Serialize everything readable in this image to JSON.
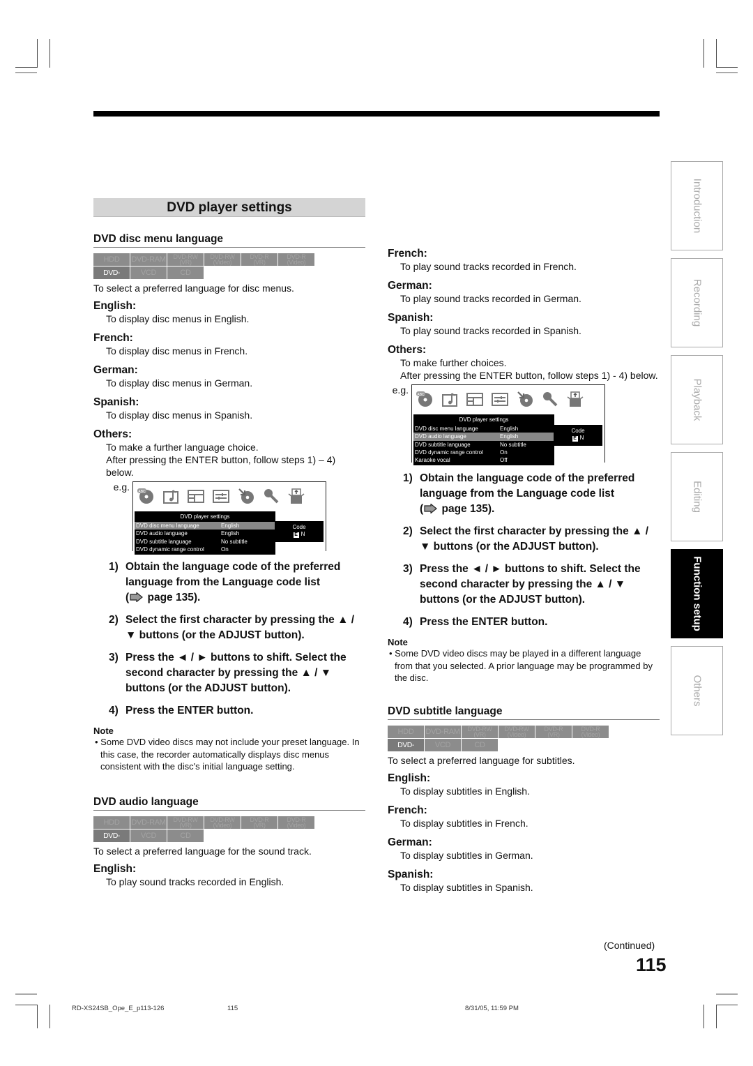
{
  "page": {
    "title": "DVD player settings",
    "continued": "(Continued)",
    "page_number": "115"
  },
  "badges": {
    "row1": [
      {
        "label": "HDD",
        "active": false
      },
      {
        "label": "DVD-RAM",
        "active": false
      },
      {
        "label": "DVD-RW (VR)",
        "l1": "DVD-RW",
        "l2": "(VR)",
        "active": false
      },
      {
        "label": "DVD-RW (Video)",
        "l1": "DVD-RW",
        "l2": "(Video)",
        "active": false
      },
      {
        "label": "DVD-R (VR)",
        "l1": "DVD-R",
        "l2": "(VR)",
        "active": false
      },
      {
        "label": "DVD-R (Video)",
        "l1": "DVD-R",
        "l2": "(Video)",
        "active": false
      }
    ],
    "row2": [
      {
        "label": "DVD-VIDEO",
        "active": true
      },
      {
        "label": "VCD",
        "active": false
      },
      {
        "label": "CD",
        "active": false
      }
    ]
  },
  "disc_menu": {
    "heading": "DVD disc menu language",
    "lead": "To select a preferred language for disc menus.",
    "options": [
      {
        "label": "English:",
        "desc": "To display disc menus in English."
      },
      {
        "label": "French:",
        "desc": "To display disc menus in French."
      },
      {
        "label": "German:",
        "desc": "To display disc menus in German."
      },
      {
        "label": "Spanish:",
        "desc": "To display disc menus in Spanish."
      },
      {
        "label": "Others:",
        "desc": "To make a further language choice.",
        "desc2": "After pressing the ENTER button, follow steps 1) – 4) below."
      }
    ],
    "eg": "e.g.",
    "screen": {
      "title": "DVD player settings",
      "rows": [
        {
          "k": "DVD disc menu language",
          "v": "English",
          "selected": true
        },
        {
          "k": "DVD audio language",
          "v": "English",
          "selected": false
        },
        {
          "k": "DVD subtitle language",
          "v": "No subtitle",
          "selected": false
        },
        {
          "k": "DVD dynamic range control",
          "v": "On",
          "selected": false
        }
      ],
      "code_label": "Code",
      "code_e": "E",
      "code_n": "N"
    },
    "steps": [
      {
        "n": "1)",
        "text": "Obtain the language code of the preferred language from the Language code list",
        "ref": "page 135)."
      },
      {
        "n": "2)",
        "text": "Select the first character by pressing the ▲ / ▼ buttons (or the ADJUST button)."
      },
      {
        "n": "3)",
        "text": "Press the ◄ / ► buttons to shift. Select the second character by pressing the ▲ / ▼ buttons (or the ADJUST button)."
      },
      {
        "n": "4)",
        "text": "Press the ENTER button."
      }
    ],
    "note_heading": "Note",
    "note": "• Some DVD video discs may not include your preset language. In this case, the recorder automatically displays disc menus consistent with the disc's initial language setting."
  },
  "audio": {
    "heading": "DVD audio language",
    "lead": "To select a preferred language for the sound track.",
    "options": [
      {
        "label": "English:",
        "desc": "To play sound tracks recorded in English."
      },
      {
        "label": "French:",
        "desc": "To play sound tracks recorded in French."
      },
      {
        "label": "German:",
        "desc": "To play sound tracks recorded in German."
      },
      {
        "label": "Spanish:",
        "desc": "To play sound tracks recorded in Spanish."
      },
      {
        "label": "Others:",
        "desc": "To make further choices.",
        "desc2": "After pressing the ENTER button, follow steps 1) - 4) below."
      }
    ],
    "eg": "e.g.",
    "screen": {
      "title": "DVD player settings",
      "rows": [
        {
          "k": "DVD disc menu language",
          "v": "English",
          "selected": false
        },
        {
          "k": "DVD audio language",
          "v": "English",
          "selected": true
        },
        {
          "k": "DVD subtitle language",
          "v": "No subtitle",
          "selected": false
        },
        {
          "k": "DVD dynamic range control",
          "v": "On",
          "selected": false
        },
        {
          "k": "Karaoke vocal",
          "v": "Off",
          "selected": false
        }
      ],
      "code_label": "Code",
      "code_e": "E",
      "code_n": "N"
    },
    "steps": [
      {
        "n": "1)",
        "text": "Obtain the language code of the preferred language from the Language code list",
        "ref": "page 135)."
      },
      {
        "n": "2)",
        "text": "Select the first character by pressing the ▲ / ▼ buttons (or the ADJUST button)."
      },
      {
        "n": "3)",
        "text": "Press the ◄ / ► buttons to shift. Select the second character by pressing the ▲ / ▼ buttons (or the ADJUST button)."
      },
      {
        "n": "4)",
        "text": "Press the ENTER button."
      }
    ],
    "note_heading": "Note",
    "note": "• Some DVD video discs may be played in a different language from that you selected. A prior language may be programmed by the disc."
  },
  "subtitle": {
    "heading": "DVD subtitle language",
    "lead": "To select a preferred language for subtitles.",
    "options": [
      {
        "label": "English:",
        "desc": "To display subtitles in English."
      },
      {
        "label": "French:",
        "desc": "To display subtitles in French."
      },
      {
        "label": "German:",
        "desc": "To display subtitles in German."
      },
      {
        "label": "Spanish:",
        "desc": "To display subtitles in Spanish."
      }
    ]
  },
  "side_tabs": [
    {
      "label": "Introduction",
      "active": false
    },
    {
      "label": "Recording",
      "active": false
    },
    {
      "label": "Playback",
      "active": false
    },
    {
      "label": "Editing",
      "active": false
    },
    {
      "label": "Function setup",
      "active": true
    },
    {
      "label": "Others",
      "active": false
    }
  ],
  "screen_icons": [
    "disc-abc-icon",
    "music-note-icon",
    "layout-icon",
    "sliders-icon",
    "disc-arrow-icon",
    "key-icon",
    "box-upload-icon"
  ],
  "footer": {
    "file": "RD-XS24SB_Ope_E_p113-126",
    "page": "115",
    "date": "8/31/05, 11:59 PM"
  }
}
